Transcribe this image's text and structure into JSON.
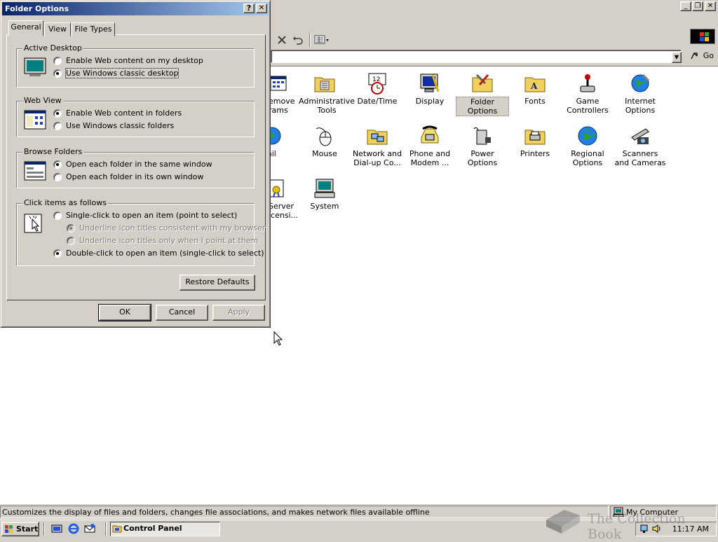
{
  "colors": {
    "title_active_start": "#0a246a",
    "title_active_end": "#a6caf0",
    "face": "#d4d0c8"
  },
  "address": {
    "go_label": "Go"
  },
  "control_panel": {
    "items": [
      {
        "label": "Add/Remove Programs",
        "visible": "emove\nrams",
        "icon": "add-remove-programs-icon"
      },
      {
        "label": "Administrative Tools",
        "icon": "administrative-tools-icon"
      },
      {
        "label": "Date/Time",
        "icon": "date-time-icon"
      },
      {
        "label": "Display",
        "icon": "display-icon"
      },
      {
        "label": "Folder Options",
        "icon": "folder-options-icon",
        "selected": true
      },
      {
        "label": "Fonts",
        "icon": "fonts-icon"
      },
      {
        "label": "Game Controllers",
        "icon": "game-controllers-icon"
      },
      {
        "label": "Internet Options",
        "icon": "internet-options-icon"
      },
      {
        "label": "Mail",
        "visible": "ail",
        "icon": "mail-icon"
      },
      {
        "label": "Mouse",
        "icon": "mouse-icon"
      },
      {
        "label": "Network and Dial-up Co...",
        "icon": "network-icon"
      },
      {
        "label": "Phone and Modem ...",
        "icon": "phone-modem-icon"
      },
      {
        "label": "Power Options",
        "icon": "power-options-icon"
      },
      {
        "label": "Printers",
        "icon": "printers-icon"
      },
      {
        "label": "Regional Options",
        "icon": "regional-options-icon"
      },
      {
        "label": "Scanners and Cameras",
        "icon": "scanners-cameras-icon"
      },
      {
        "label": "Server Licensing",
        "visible": "Server\nicensi...",
        "icon": "server-licensing-icon"
      },
      {
        "label": "System",
        "icon": "system-icon"
      }
    ]
  },
  "status_bar": {
    "text": "Customizes the display of files and folders, changes file associations, and makes network files available offline",
    "zone": "My Computer"
  },
  "dialog": {
    "title": "Folder Options",
    "help_glyph": "?",
    "close_glyph": "✕",
    "tabs": [
      "General",
      "View",
      "File Types"
    ],
    "active_tab": "General",
    "groups": {
      "active_desktop": {
        "title": "Active Desktop",
        "options": [
          "Enable Web content on my desktop",
          "Use Windows classic desktop"
        ],
        "selected": 1
      },
      "web_view": {
        "title": "Web View",
        "options": [
          "Enable Web content in folders",
          "Use Windows classic folders"
        ],
        "selected": 0
      },
      "browse_folders": {
        "title": "Browse Folders",
        "options": [
          "Open each folder in the same window",
          "Open each folder in its own window"
        ],
        "selected": 0
      },
      "click_items": {
        "title": "Click items as follows",
        "options": [
          "Single-click to open an item (point to select)",
          "Underline icon titles consistent with my browser",
          "Underline icon titles only when I point at them",
          "Double-click to open an item (single-click to select)"
        ],
        "selected": 3,
        "sub_selected": 1
      }
    },
    "restore_defaults": "Restore Defaults",
    "ok": "OK",
    "cancel": "Cancel",
    "apply": "Apply"
  },
  "taskbar": {
    "start": "Start",
    "task": "Control Panel",
    "clock": "11:17 AM"
  },
  "watermark": "The Collection Book"
}
